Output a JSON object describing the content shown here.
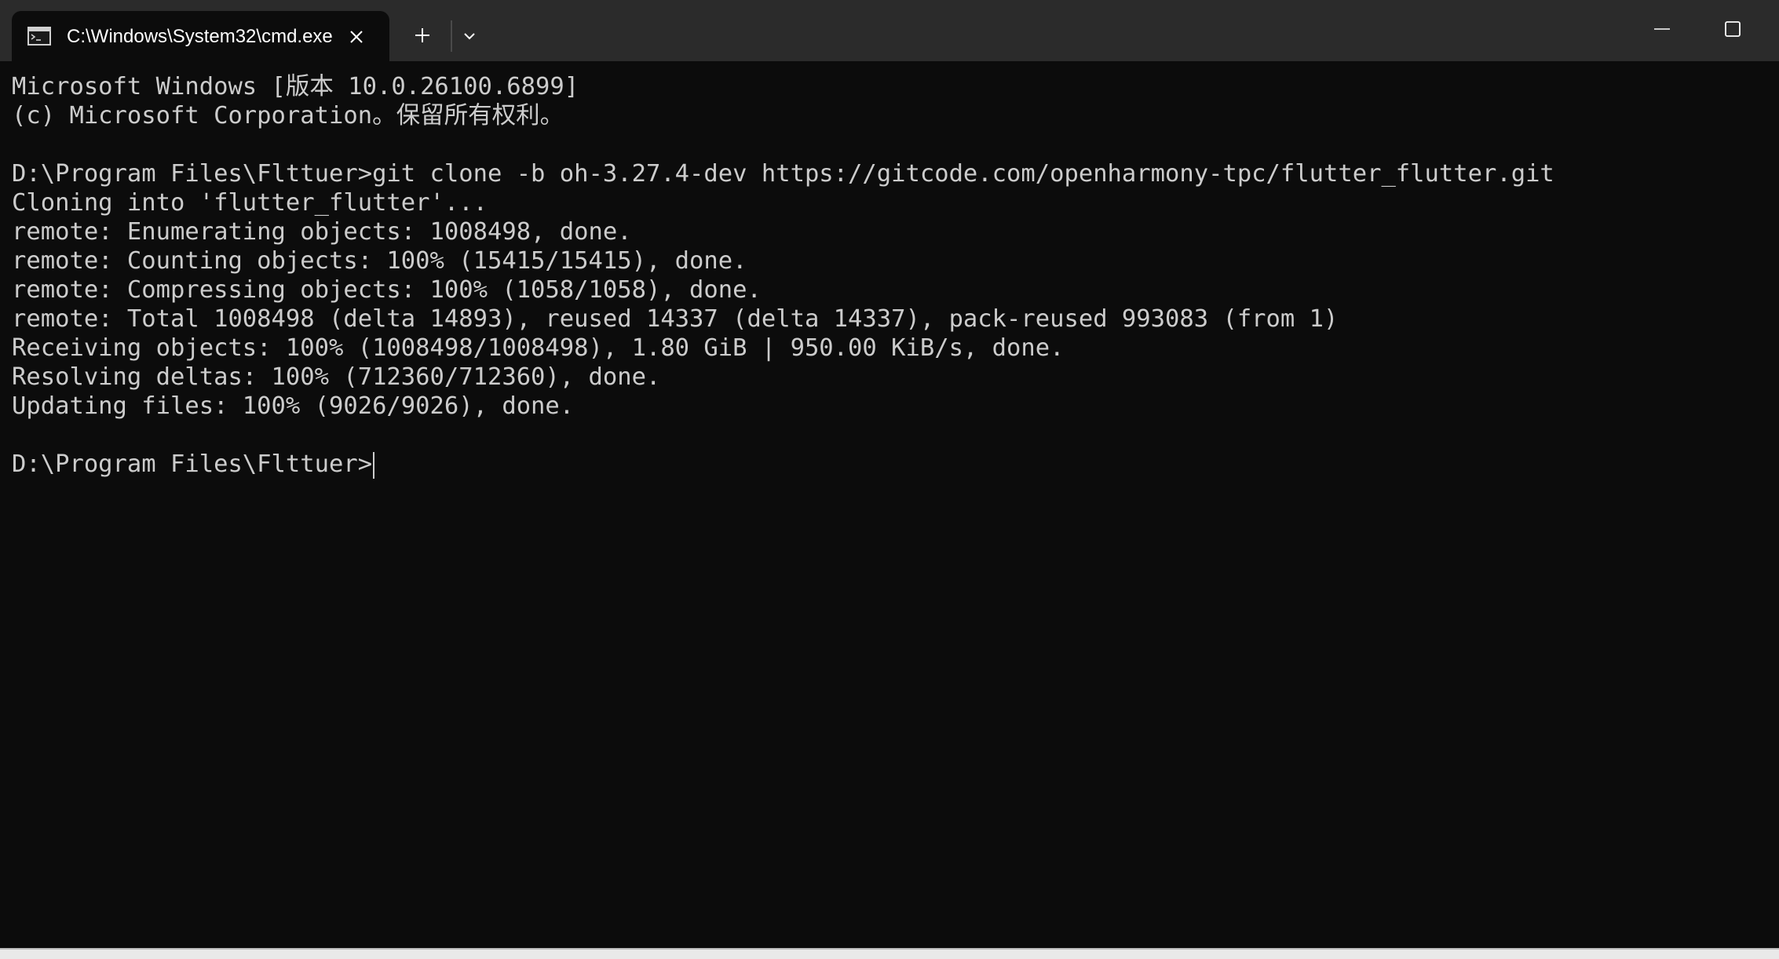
{
  "window": {
    "tab_title": "C:\\Windows\\System32\\cmd.exe",
    "icons": {
      "tab": "cmd-icon",
      "close": "close-icon",
      "new_tab": "plus-icon",
      "dropdown": "chevron-down-icon",
      "minimize": "minimize-icon",
      "maximize": "maximize-icon"
    }
  },
  "colors": {
    "background": "#0c0c0c",
    "titlebar": "#2b2b2b",
    "text": "#cccccc"
  },
  "terminal": {
    "lines": [
      "Microsoft Windows [版本 10.0.26100.6899]",
      "(c) Microsoft Corporation。保留所有权利。",
      "",
      "D:\\Program Files\\Flttuer>git clone -b oh-3.27.4-dev https://gitcode.com/openharmony-tpc/flutter_flutter.git",
      "Cloning into 'flutter_flutter'...",
      "remote: Enumerating objects: 1008498, done.",
      "remote: Counting objects: 100% (15415/15415), done.",
      "remote: Compressing objects: 100% (1058/1058), done.",
      "remote: Total 1008498 (delta 14893), reused 14337 (delta 14337), pack-reused 993083 (from 1)",
      "Receiving objects: 100% (1008498/1008498), 1.80 GiB | 950.00 KiB/s, done.",
      "Resolving deltas: 100% (712360/712360), done.",
      "Updating files: 100% (9026/9026), done.",
      "",
      "D:\\Program Files\\Flttuer>"
    ]
  }
}
